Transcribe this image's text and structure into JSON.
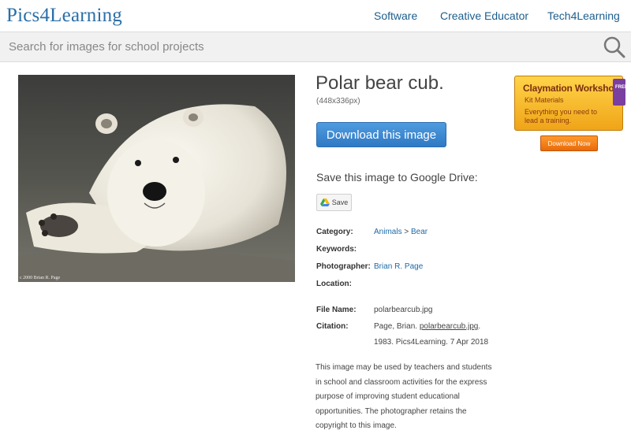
{
  "site": {
    "logo": "Pics4Learning",
    "nav": [
      "Software",
      "Creative Educator",
      "Tech4Learning"
    ]
  },
  "search": {
    "placeholder": "Search for images for school projects",
    "icon": "search-icon"
  },
  "image": {
    "credit": "c 2000 Brian R. Page",
    "title": "Polar bear cub.",
    "dimensions": "(448x336px)",
    "download_label": "Download this image",
    "drive_label": "Save this image to Google Drive:",
    "drive_button": "Save",
    "drive_icon": "google-drive-icon"
  },
  "details": {
    "category_label": "Category:",
    "category_link1": "Animals",
    "category_sep": ">",
    "category_link2": "Bear",
    "keywords_label": "Keywords:",
    "photographer_label": "Photographer:",
    "photographer": "Brian R. Page",
    "location_label": "Location:",
    "filename_label": "File Name:",
    "filename": "polarbearcub.jpg",
    "citation_label": "Citation:",
    "citation_pre": "Page, Brian.",
    "citation_file": "polarbearcub.jpg",
    "citation_dot": ".",
    "citation_line2": "1983. Pics4Learning. 7 Apr 2018"
  },
  "notice": "This image may be used by teachers and students in school and classroom activities for the express purpose of improving student educational opportunities. The photographer retains the copyright to this image.",
  "ad": {
    "title": "Claymation Workshop",
    "subtitle": "Kit Materials",
    "body": "Everything you need to lead a training.",
    "ribbon": "FREE",
    "button": "Download Now"
  },
  "colors": {
    "link": "#1c6aa8",
    "button": "#3a85d0",
    "ad_orange": "#f0a418"
  }
}
